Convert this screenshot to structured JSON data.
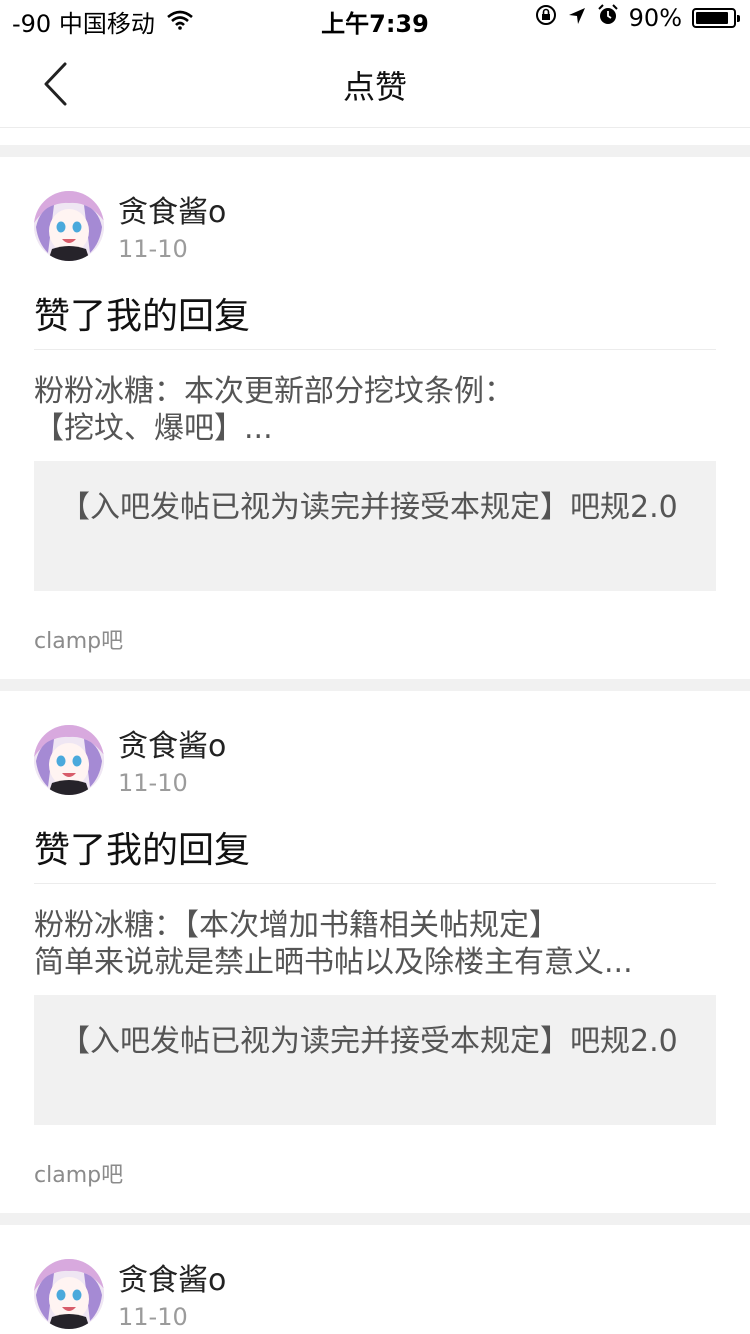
{
  "status_bar": {
    "signal": "-90",
    "carrier": "中国移动",
    "time": "上午7:39",
    "battery_percent": "90%",
    "battery_level": 0.9,
    "icons": [
      "wifi-icon",
      "orientation-lock-icon",
      "location-icon",
      "alarm-icon",
      "battery-icon"
    ]
  },
  "nav": {
    "title": "点赞",
    "back_icon": "chevron-left-icon"
  },
  "items": [
    {
      "user": "贪食酱o",
      "date": "11-10",
      "action": "赞了我的回复",
      "reply_line1": "粉粉冰糖：本次更新部分挖坟条例：",
      "reply_line2": "【挖坟、爆吧】...",
      "quote": "【入吧发帖已视为读完并接受本规定】吧规2.0",
      "forum": "clamp吧"
    },
    {
      "user": "贪食酱o",
      "date": "11-10",
      "action": "赞了我的回复",
      "reply_line1": "粉粉冰糖：【本次增加书籍相关帖规定】",
      "reply_line2": "简单来说就是禁止晒书帖以及除楼主有意义...",
      "quote": "【入吧发帖已视为读完并接受本规定】吧规2.0",
      "forum": "clamp吧"
    },
    {
      "user": "贪食酱o",
      "date": "11-10"
    }
  ]
}
